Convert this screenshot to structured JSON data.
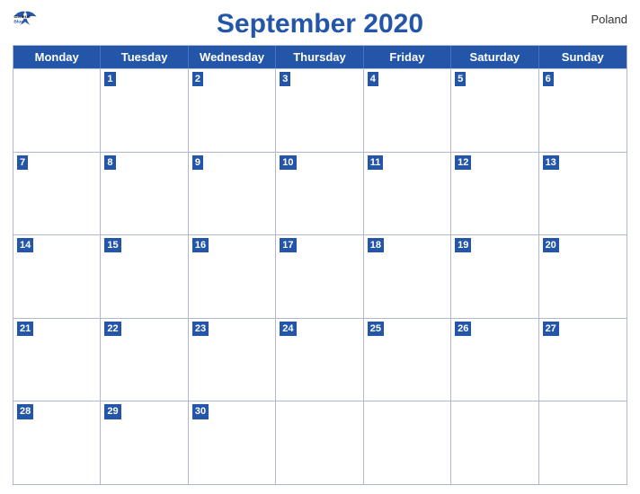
{
  "logo": {
    "general": "General",
    "blue": "Blue",
    "bird_color": "#2356a8"
  },
  "title": "September 2020",
  "country": "Poland",
  "day_headers": [
    "Monday",
    "Tuesday",
    "Wednesday",
    "Thursday",
    "Friday",
    "Saturday",
    "Sunday"
  ],
  "weeks": [
    [
      {
        "num": "",
        "empty": true
      },
      {
        "num": "1"
      },
      {
        "num": "2"
      },
      {
        "num": "3"
      },
      {
        "num": "4"
      },
      {
        "num": "5"
      },
      {
        "num": "6"
      }
    ],
    [
      {
        "num": "7"
      },
      {
        "num": "8"
      },
      {
        "num": "9"
      },
      {
        "num": "10"
      },
      {
        "num": "11"
      },
      {
        "num": "12"
      },
      {
        "num": "13"
      }
    ],
    [
      {
        "num": "14"
      },
      {
        "num": "15"
      },
      {
        "num": "16"
      },
      {
        "num": "17"
      },
      {
        "num": "18"
      },
      {
        "num": "19"
      },
      {
        "num": "20"
      }
    ],
    [
      {
        "num": "21"
      },
      {
        "num": "22"
      },
      {
        "num": "23"
      },
      {
        "num": "24"
      },
      {
        "num": "25"
      },
      {
        "num": "26"
      },
      {
        "num": "27"
      }
    ],
    [
      {
        "num": "28"
      },
      {
        "num": "29"
      },
      {
        "num": "30"
      },
      {
        "num": "",
        "empty": true
      },
      {
        "num": "",
        "empty": true
      },
      {
        "num": "",
        "empty": true
      },
      {
        "num": "",
        "empty": true
      }
    ]
  ],
  "accent_color": "#2356a8"
}
